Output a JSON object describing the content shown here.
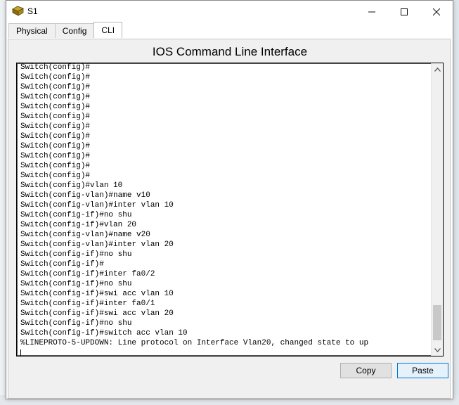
{
  "window": {
    "title": "S1",
    "accent": "#0078d7"
  },
  "tabs": [
    {
      "label": "Physical"
    },
    {
      "label": "Config"
    },
    {
      "label": "CLI"
    }
  ],
  "panel": {
    "heading": "IOS Command Line Interface"
  },
  "terminal": {
    "lines": [
      "Switch(config)#",
      "Switch(config)#",
      "Switch(config)#",
      "Switch(config)#",
      "Switch(config)#",
      "Switch(config)#",
      "Switch(config)#",
      "Switch(config)#",
      "Switch(config)#",
      "Switch(config)#",
      "Switch(config)#",
      "Switch(config)#",
      "Switch(config)#vlan 10",
      "Switch(config-vlan)#name v10",
      "Switch(config-vlan)#inter vlan 10",
      "Switch(config-if)#no shu",
      "Switch(config-if)#vlan 20",
      "Switch(config-vlan)#name v20",
      "Switch(config-vlan)#inter vlan 20",
      "Switch(config-if)#no shu",
      "Switch(config-if)#",
      "Switch(config-if)#inter fa0/2",
      "Switch(config-if)#no shu",
      "Switch(config-if)#swi acc vlan 10",
      "Switch(config-if)#inter fa0/1",
      "Switch(config-if)#swi acc vlan 20",
      "Switch(config-if)#no shu",
      "Switch(config-if)#switch acc vlan 10",
      "%LINEPROTO-5-UPDOWN: Line protocol on Interface Vlan20, changed state to up"
    ]
  },
  "buttons": {
    "copy": "Copy",
    "paste": "Paste"
  },
  "icons": {
    "app": "packet-tracer-switch-icon",
    "minimize": "minimize-icon",
    "maximize": "maximize-icon",
    "close": "close-icon",
    "scroll_up": "chevron-up-icon",
    "scroll_down": "chevron-down-icon"
  }
}
